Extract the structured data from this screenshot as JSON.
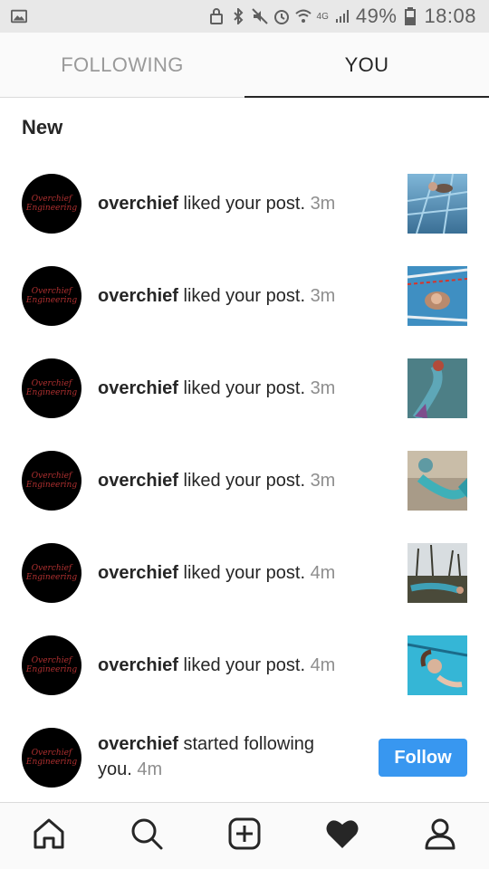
{
  "status_bar": {
    "network": "4G",
    "battery": "49%",
    "time": "18:08",
    "icons": [
      "image-icon",
      "lock-icon",
      "bluetooth-icon",
      "mute-icon",
      "alarm-icon",
      "wifi-icon",
      "signal-icon",
      "battery-icon"
    ]
  },
  "tabs": [
    {
      "label": "FOLLOWING",
      "active": false
    },
    {
      "label": "YOU",
      "active": true
    }
  ],
  "section": {
    "title": "New"
  },
  "notifications": [
    {
      "user": "overchief",
      "action": " liked your post. ",
      "time": "3m",
      "type": "like",
      "thumb": "pool-swimmer"
    },
    {
      "user": "overchief",
      "action": " liked your post. ",
      "time": "3m",
      "type": "like",
      "thumb": "pool-mermaid"
    },
    {
      "user": "overchief",
      "action": " liked your post. ",
      "time": "3m",
      "type": "like",
      "thumb": "underwater-mermaid"
    },
    {
      "user": "overchief",
      "action": " liked your post. ",
      "time": "3m",
      "type": "like",
      "thumb": "mermaid-rocks"
    },
    {
      "user": "overchief",
      "action": " liked your post. ",
      "time": "4m",
      "type": "like",
      "thumb": "mermaid-forest"
    },
    {
      "user": "overchief",
      "action": " liked your post. ",
      "time": "4m",
      "type": "like",
      "thumb": "mermaid-pool-blue"
    }
  ],
  "follow_notification": {
    "user": "overchief",
    "action_line1": " started following",
    "action_line2": "you. ",
    "time": "4m",
    "button_label": "Follow"
  },
  "avatar": {
    "line1": "Overchief",
    "line2": "Engineering"
  },
  "bottom_nav": [
    "home-icon",
    "search-icon",
    "add-post-icon",
    "heart-icon",
    "profile-icon"
  ],
  "colors": {
    "accent": "#3897f0",
    "text": "#262626",
    "muted": "#8e8e8e"
  }
}
